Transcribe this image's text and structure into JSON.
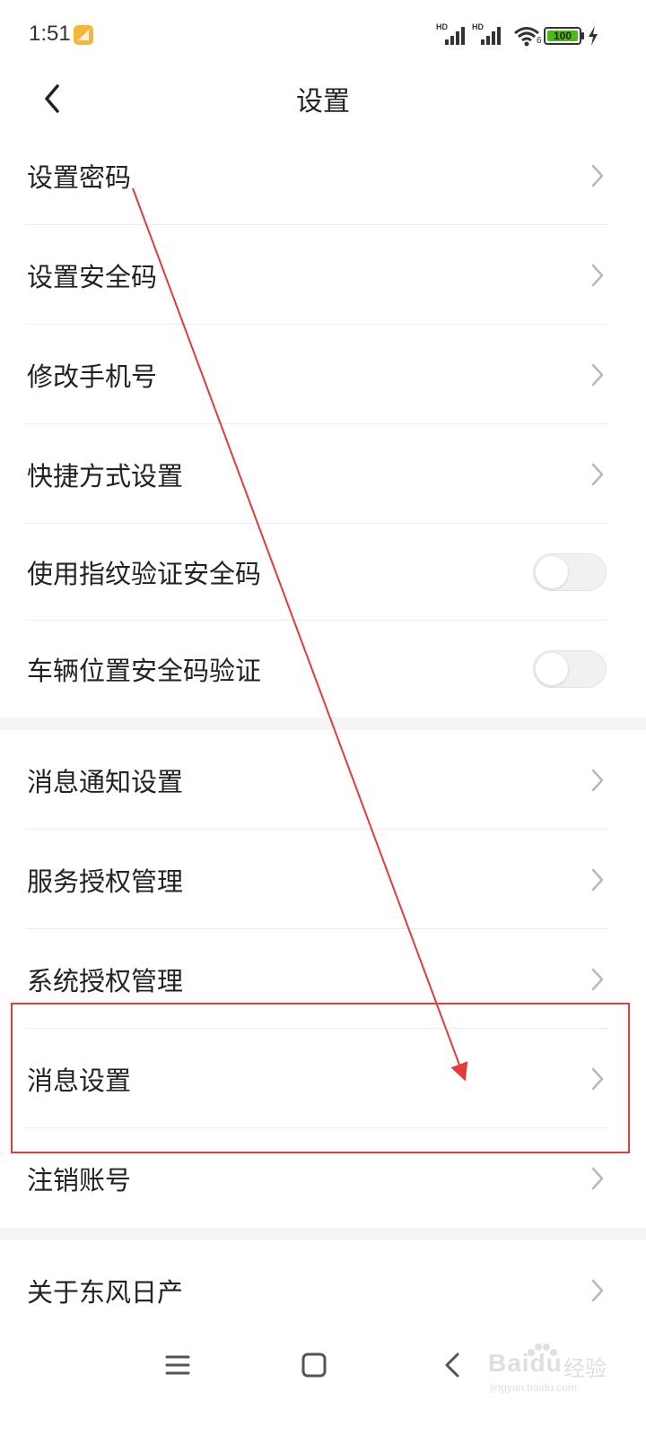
{
  "status_bar": {
    "time": "1:51",
    "signal_1_label": "HD",
    "signal_2_label": "HD",
    "wifi_sub": "6",
    "battery": "100",
    "battery_color": "#4cbb17"
  },
  "header": {
    "title": "设置",
    "back_icon": "chevron-left-icon"
  },
  "sections": [
    {
      "items": [
        {
          "label": "设置密码",
          "control": "chevron"
        },
        {
          "label": "设置安全码",
          "control": "chevron"
        },
        {
          "label": "修改手机号",
          "control": "chevron"
        },
        {
          "label": "快捷方式设置",
          "control": "chevron"
        },
        {
          "label": "使用指纹验证安全码",
          "control": "toggle",
          "on": false
        },
        {
          "label": "车辆位置安全码验证",
          "control": "toggle",
          "on": false
        }
      ]
    },
    {
      "items": [
        {
          "label": "消息通知设置",
          "control": "chevron"
        },
        {
          "label": "服务授权管理",
          "control": "chevron"
        },
        {
          "label": "系统授权管理",
          "control": "chevron"
        },
        {
          "label": "消息设置",
          "control": "chevron"
        },
        {
          "label": "注销账号",
          "control": "chevron"
        }
      ]
    },
    {
      "items": [
        {
          "label": "关于东风日产",
          "control": "chevron"
        }
      ]
    }
  ],
  "annotation": {
    "color": "#e23b3b",
    "arrow_from": "设置密码",
    "highlighted_item": "消息设置"
  },
  "nav_bar": {
    "menu_icon": "menu-icon",
    "home_icon": "home-square-icon",
    "back_icon": "back-triangle-icon"
  },
  "watermark": {
    "brand": "Baidu",
    "text": "经验",
    "url": "jingyan.baidu.com"
  }
}
